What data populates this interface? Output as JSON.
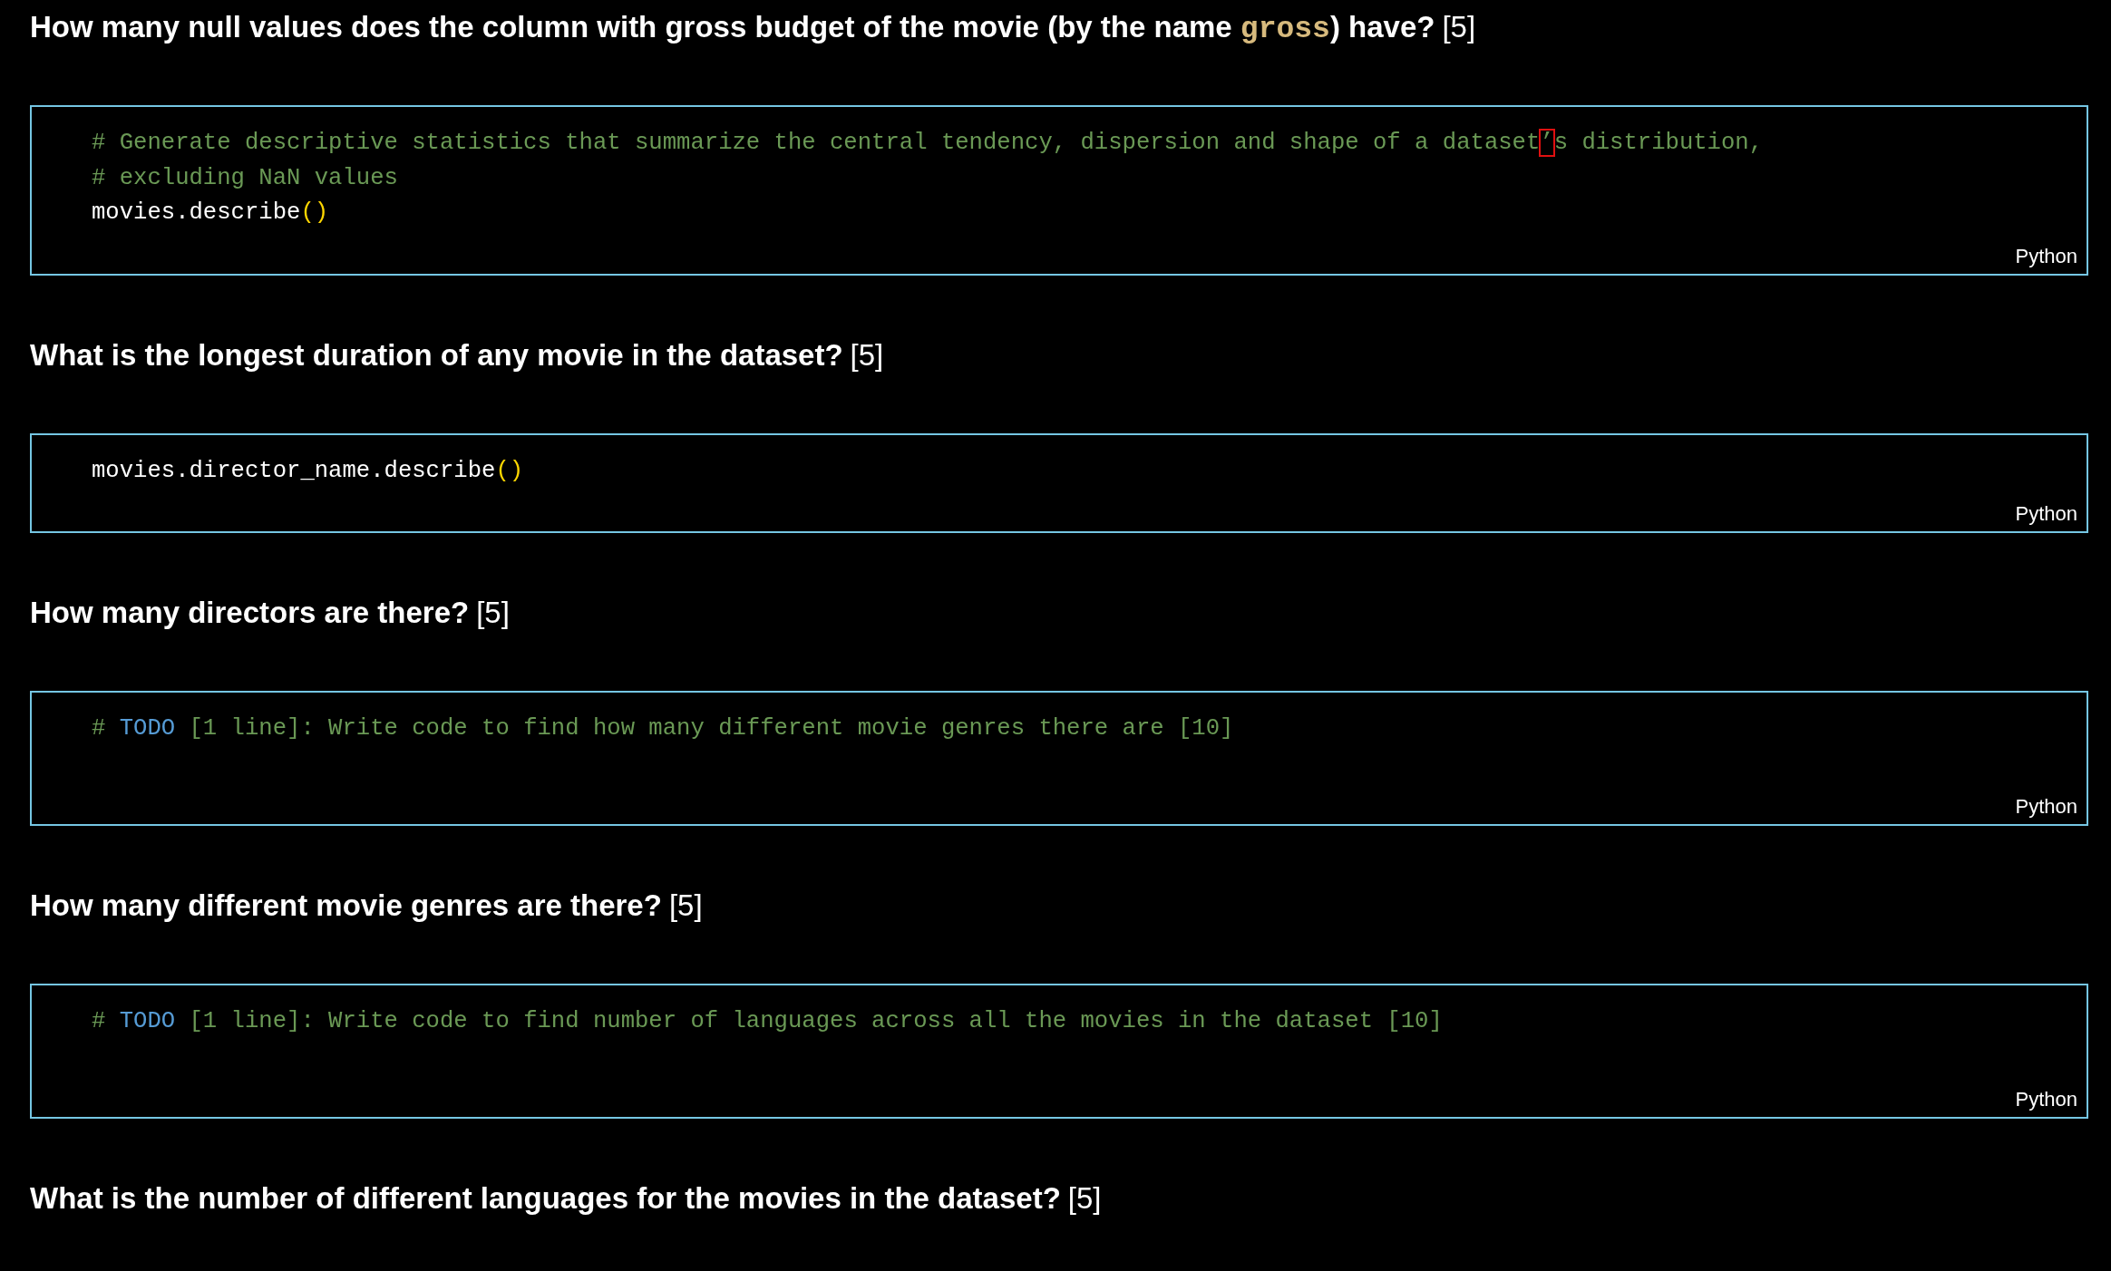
{
  "cells": [
    {
      "kind": "markdown",
      "question": [
        {
          "kind": "strong",
          "text": "How many null values does the column with gross budget of the movie (by the name "
        },
        {
          "kind": "code",
          "text": "gross"
        },
        {
          "kind": "strong",
          "text": ") have?"
        }
      ],
      "points": "[5]"
    },
    {
      "kind": "code",
      "language": "Python",
      "trailing_blank_line": false,
      "lines": [
        {
          "tokens": [
            {
              "kind": "comment",
              "text": "# Generate descriptive statistics that summarize the central tendency, dispersion and shape of a dataset"
            },
            {
              "kind": "ambiguous-char",
              "text": "’"
            },
            {
              "kind": "comment",
              "text": "s distribution,"
            }
          ]
        },
        {
          "tokens": [
            {
              "kind": "comment",
              "text": "# excluding NaN values"
            }
          ]
        },
        {
          "tokens": [
            {
              "kind": "plain",
              "text": "movies.describe"
            },
            {
              "kind": "bracket",
              "text": "()"
            }
          ]
        }
      ]
    },
    {
      "kind": "markdown",
      "question": [
        {
          "kind": "strong",
          "text": "What is the longest duration of any movie in the dataset?"
        }
      ],
      "points": "[5]"
    },
    {
      "kind": "code",
      "language": "Python",
      "trailing_blank_line": false,
      "lines": [
        {
          "tokens": [
            {
              "kind": "plain",
              "text": "movies.director_name.describe"
            },
            {
              "kind": "bracket",
              "text": "()"
            }
          ]
        }
      ]
    },
    {
      "kind": "markdown",
      "question": [
        {
          "kind": "strong",
          "text": "How many directors are there?"
        }
      ],
      "points": "[5]"
    },
    {
      "kind": "code",
      "language": "Python",
      "trailing_blank_line": true,
      "lines": [
        {
          "tokens": [
            {
              "kind": "comment",
              "text": "# "
            },
            {
              "kind": "todo",
              "text": "TODO"
            },
            {
              "kind": "comment",
              "text": " [1 line]: Write code to find how many different movie genres there are [10]"
            }
          ]
        }
      ]
    },
    {
      "kind": "markdown",
      "question": [
        {
          "kind": "strong",
          "text": "How many different movie genres are there?"
        }
      ],
      "points": "[5]"
    },
    {
      "kind": "code",
      "language": "Python",
      "trailing_blank_line": true,
      "lines": [
        {
          "tokens": [
            {
              "kind": "comment",
              "text": "# "
            },
            {
              "kind": "todo",
              "text": "TODO"
            },
            {
              "kind": "comment",
              "text": " [1 line]: Write code to find number of languages across all the movies in the dataset [10]"
            }
          ]
        }
      ]
    },
    {
      "kind": "markdown",
      "question": [
        {
          "kind": "strong",
          "text": "What is the number of different languages for the movies in the dataset?"
        }
      ],
      "points": "[5]"
    }
  ]
}
